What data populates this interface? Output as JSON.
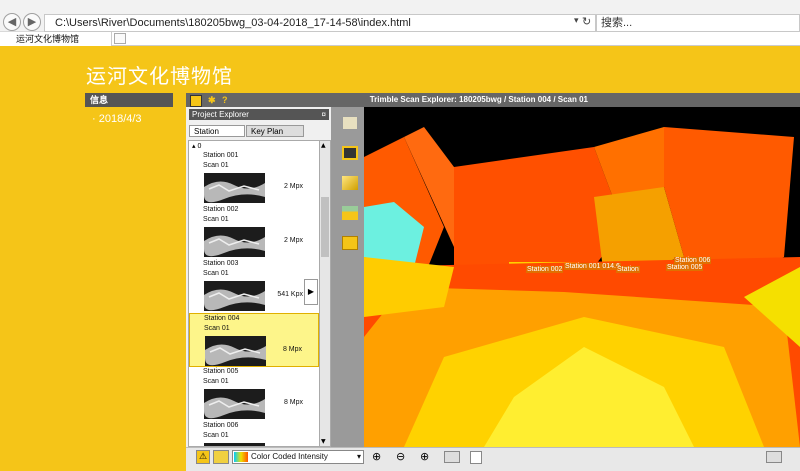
{
  "browser": {
    "address": "C:\\Users\\River\\Documents\\180205bwg_03-04-2018_17-14-58\\index.html",
    "search_placeholder": "搜索...",
    "tab_title": "运河文化博物馆"
  },
  "page": {
    "title": "运河文化博物馆",
    "sidebar_header": "信息",
    "sidebar_item": "2018/4/3"
  },
  "viewer": {
    "title": "Trimble Scan Explorer: 180205bwg / Station 004 / Scan 01",
    "project_explorer": "Project Explorer",
    "tab_station": "Station",
    "tab_keyplan": "Key Plan",
    "tree_root": "0",
    "stations": [
      {
        "name": "Station 001",
        "scan": "Scan 01",
        "size": "2 Mpx"
      },
      {
        "name": "Station 002",
        "scan": "Scan 01",
        "size": "2 Mpx"
      },
      {
        "name": "Station 003",
        "scan": "Scan 01",
        "size": "541 Kpx"
      },
      {
        "name": "Station 004",
        "scan": "Scan 01",
        "size": "8 Mpx",
        "selected": true
      },
      {
        "name": "Station 005",
        "scan": "Scan 01",
        "size": "8 Mpx"
      },
      {
        "name": "Station 006",
        "scan": "Scan 01",
        "size": ""
      }
    ],
    "color_mode": "Color Coded Intensity",
    "scan_labels": [
      "Station 002",
      "Station 001 014.6",
      "Station",
      "Station 006",
      "Station 005"
    ]
  }
}
